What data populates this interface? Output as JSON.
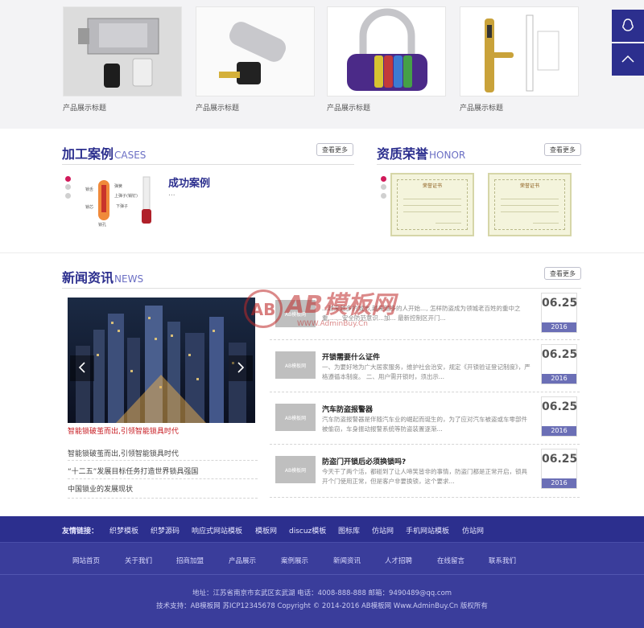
{
  "products": [
    {
      "caption": "产品展示标题"
    },
    {
      "caption": "产品展示标题"
    },
    {
      "caption": "产品展示标题"
    },
    {
      "caption": "产品展示标题"
    }
  ],
  "cases": {
    "title": "加工案例",
    "title_en": "CASES",
    "more": "查看更多",
    "heading": "成功案例",
    "desc": "...",
    "diagram_labels": [
      "锁舌",
      "弹簧",
      "上弹子(销钉)",
      "下弹子",
      "锁芯",
      "锁孔"
    ]
  },
  "honor": {
    "title": "资质荣誉",
    "title_en": "HONOR",
    "more": "查看更多",
    "certificates": [
      {
        "title": "荣誉证书"
      },
      {
        "title": "荣誉证书"
      }
    ]
  },
  "news": {
    "title": "新闻资讯",
    "title_en": "NEWS",
    "more": "查看更多",
    "featured_caption": "智能锁破茧而出,引领智能锁具时代",
    "links": [
      "智能锁破茧而出,引领智能锁具时代",
      "“十二五”发展目标任务打造世界锁具强国",
      "中国锁业的发展现状"
    ],
    "items": [
      {
        "title": "",
        "desc": "...越来越多的城市,越来越多的人开始..., 怎样防盗成为领城老百姓的重中之重,……安全防范意识...加... 最新控制区开门...",
        "month_day": "06.25",
        "year": "2016"
      },
      {
        "title": "开锁需要什么证件",
        "desc": "一、为要好地为广大居家服务，维护社会治安，规定《开锁验证登记制度》，严格遵循本制度。 二、用户需开锁时，须出示...",
        "month_day": "06.25",
        "year": "2016"
      },
      {
        "title": "汽车防盗报警器",
        "desc": "汽车防盗报警器是伴随汽车业的崛起而诞生的，为了应对汽车被盗或车零部件被偷窃，车身振动报警系统等防盗装置逐渐...",
        "month_day": "06.25",
        "year": "2016"
      },
      {
        "title": "防盗门开锁后必须换锁吗?",
        "desc": "今天干了两个活，都碰到了让人啼笑皆非的事情，防盗门都是正常开启，锁具开个门使用正常，但是客户非要换锁，这个要求...",
        "month_day": "06.25",
        "year": "2016"
      }
    ],
    "thumb_label": "AB模板网"
  },
  "watermark": {
    "big": "AB模板网",
    "logo": "AB",
    "url": "WWW.AdminBuy.Cn"
  },
  "footer": {
    "friend_label": "友情链接：",
    "friend_links": [
      "织梦模板",
      "织梦源码",
      "响应式网站模板",
      "模板网",
      "discuz模板",
      "图标库",
      "仿站网",
      "手机网站模板",
      "仿站网"
    ],
    "nav": [
      "网站首页",
      "关于我们",
      "招商加盟",
      "产品展示",
      "案例展示",
      "新闻资讯",
      "人才招聘",
      "在线留言",
      "联系我们"
    ],
    "address": "地址：江苏省南京市玄武区玄武湖   电话：4008-888-888   邮箱：9490489@qq.com",
    "copyright": "技术支持：AB模板网   苏ICP12345678   Copyright © 2014-2016 AB模板网 Www.AdminBuy.Cn 版权所有"
  }
}
